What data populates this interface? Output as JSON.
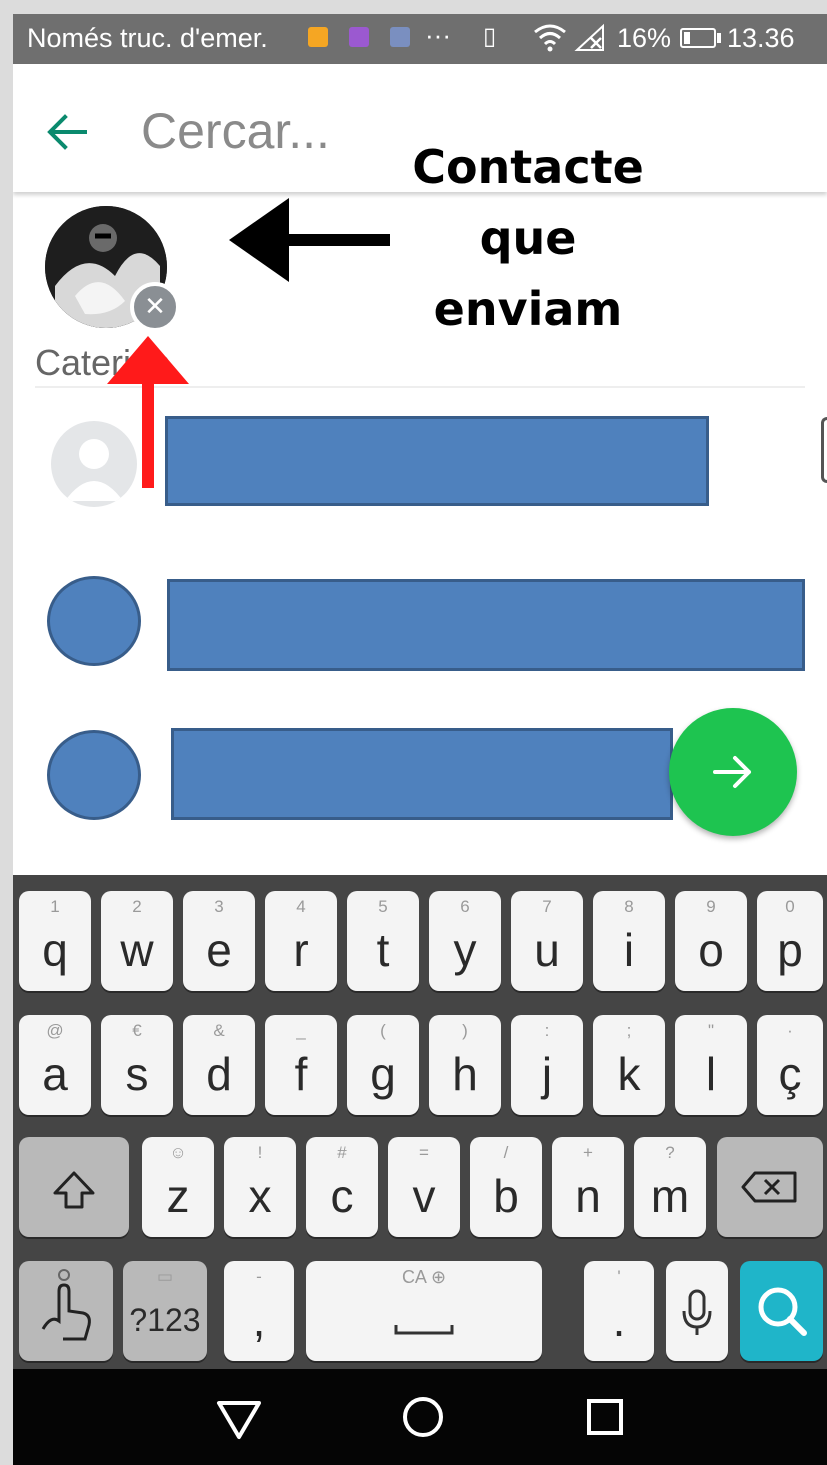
{
  "status_bar": {
    "carrier": "Només truc. d'emer.",
    "overflow": "···",
    "battery_percent": "16%",
    "time": "13.36",
    "notification_colors": [
      "#f5a623",
      "#9b59d0",
      "#7a8fc0"
    ]
  },
  "search": {
    "back_icon": "arrow-left-icon",
    "placeholder": "Cercar..."
  },
  "selected_contact": {
    "name": "Caterina",
    "remove_icon": "close-icon",
    "remove_glyph": "✕"
  },
  "annotation": {
    "label_lines": [
      "Contacte",
      "que",
      "enviam"
    ],
    "arrow_color": "#000000",
    "highlight_color": "#ff1a1a"
  },
  "redaction_color": "#4f81bd",
  "fab": {
    "icon": "arrow-right-icon",
    "color": "#1ec450"
  },
  "keyboard": {
    "row1": [
      {
        "key": "q",
        "hint": "1"
      },
      {
        "key": "w",
        "hint": "2"
      },
      {
        "key": "e",
        "hint": "3"
      },
      {
        "key": "r",
        "hint": "4"
      },
      {
        "key": "t",
        "hint": "5"
      },
      {
        "key": "y",
        "hint": "6"
      },
      {
        "key": "u",
        "hint": "7"
      },
      {
        "key": "i",
        "hint": "8"
      },
      {
        "key": "o",
        "hint": "9"
      },
      {
        "key": "p",
        "hint": "0"
      }
    ],
    "row2": [
      {
        "key": "a",
        "hint": "@"
      },
      {
        "key": "s",
        "hint": "€"
      },
      {
        "key": "d",
        "hint": "&"
      },
      {
        "key": "f",
        "hint": "_"
      },
      {
        "key": "g",
        "hint": "("
      },
      {
        "key": "h",
        "hint": ")"
      },
      {
        "key": "j",
        "hint": ":"
      },
      {
        "key": "k",
        "hint": ";"
      },
      {
        "key": "l",
        "hint": "\""
      },
      {
        "key": "ç",
        "hint": "·"
      }
    ],
    "row3": [
      {
        "key": "z",
        "hint": "☺"
      },
      {
        "key": "x",
        "hint": "!"
      },
      {
        "key": "c",
        "hint": "#"
      },
      {
        "key": "v",
        "hint": "="
      },
      {
        "key": "b",
        "hint": "/"
      },
      {
        "key": "n",
        "hint": "+"
      },
      {
        "key": "m",
        "hint": "?"
      }
    ],
    "shift_icon": "shift-icon",
    "backspace_icon": "backspace-icon",
    "gesture_icon": "swipe-gesture-icon",
    "symbols_label": "?123",
    "comma": {
      "key": ",",
      "hint": "-"
    },
    "space_hint": "CA",
    "space_icon": "globe-icon",
    "period": {
      "key": ".",
      "hint": "'"
    },
    "mic_icon": "microphone-icon",
    "search_icon": "search-icon"
  },
  "nav_bar": {
    "back_icon": "triangle-back-icon",
    "home_icon": "circle-home-icon",
    "recents_icon": "square-recents-icon"
  }
}
